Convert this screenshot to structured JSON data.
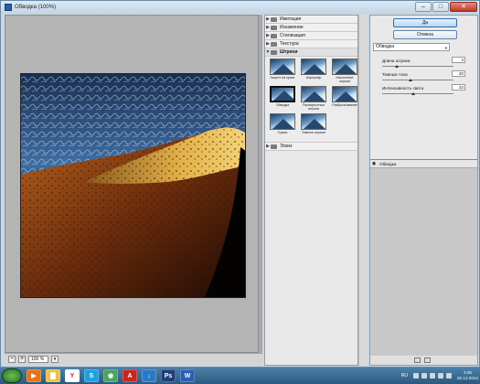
{
  "window": {
    "title": "Обводка (100%)",
    "minimize": "–",
    "maximize": "□",
    "close": "✕"
  },
  "preview": {
    "zoom": "100 %",
    "zoom_out": "−",
    "zoom_in": "+"
  },
  "gallery": {
    "categories": [
      {
        "label": "Имитация"
      },
      {
        "label": "Искажение"
      },
      {
        "label": "Стилизация"
      },
      {
        "label": "Текстура"
      }
    ],
    "open_category": {
      "label": "Штрихи",
      "thumbs": [
        {
          "label": "Акцент на краях"
        },
        {
          "label": "Аэрограф"
        },
        {
          "label": "Наклонные штрихи"
        },
        {
          "label": "Обводка",
          "selected": true
        },
        {
          "label": "Перекрестные штрихи"
        },
        {
          "label": "Разбрызгивание"
        },
        {
          "label": "Сумиэ"
        },
        {
          "label": "Темные штрихи"
        }
      ]
    },
    "last_category": {
      "label": "Эскиз"
    }
  },
  "settings": {
    "ok_label": "Да",
    "cancel_label": "Отмена",
    "filter_selected": "Обводка",
    "params": [
      {
        "label": "Длина штриха",
        "value": "4",
        "fraction": 0.2
      },
      {
        "label": "Темные тона",
        "value": "20",
        "fraction": 0.4
      },
      {
        "label": "Интенсивность света",
        "value": "22",
        "fraction": 0.44
      }
    ],
    "layer_name": "Обводка"
  },
  "taskbar": {
    "apps": [
      {
        "name": "media-player",
        "color": "#e3731d",
        "glyph": "▶"
      },
      {
        "name": "file-explorer",
        "color": "#e8c24a",
        "glyph": "▇"
      },
      {
        "name": "yandex-browser",
        "color": "#ffffff",
        "glyph": "Y"
      },
      {
        "name": "skype",
        "color": "#1ea0e0",
        "glyph": "S"
      },
      {
        "name": "network",
        "color": "#4aa35f",
        "glyph": "◉"
      },
      {
        "name": "acrobat",
        "color": "#c8271e",
        "glyph": "A"
      },
      {
        "name": "downloader",
        "color": "#2a78c8",
        "glyph": "↓"
      },
      {
        "name": "photoshop",
        "color": "#1f3e75",
        "glyph": "Ps"
      },
      {
        "name": "word",
        "color": "#2b5fb4",
        "glyph": "W"
      }
    ],
    "language": "RU",
    "time": "3:25",
    "date": "02.12.2014"
  }
}
